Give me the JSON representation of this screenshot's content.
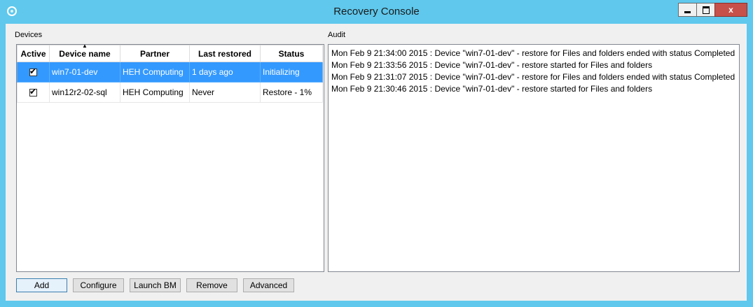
{
  "window": {
    "title": "Recovery Console",
    "min_icon": "minimize-icon",
    "max_icon": "maximize-icon",
    "close_glyph": "x"
  },
  "devices": {
    "label": "Devices",
    "columns": [
      "Active",
      "Device name",
      "Partner",
      "Last restored",
      "Status"
    ],
    "sorted_column": "Device name",
    "rows": [
      {
        "active": true,
        "device": "win7-01-dev",
        "partner": "HEH Computing",
        "last_restored": "1 days ago",
        "status": "Initializing",
        "selected": true
      },
      {
        "active": true,
        "device": "win12r2-02-sql",
        "partner": "HEH Computing",
        "last_restored": "Never",
        "status": "Restore - 1%",
        "selected": false
      }
    ]
  },
  "audit": {
    "label": "Audit",
    "lines": [
      "Mon Feb 9 21:34:00 2015 : Device \"win7-01-dev\" - restore for Files and folders ended with status Completed",
      "Mon Feb 9 21:33:56 2015 : Device \"win7-01-dev\" - restore started for Files and folders",
      "Mon Feb 9 21:31:07 2015 : Device \"win7-01-dev\" - restore for Files and folders ended with status Completed",
      "Mon Feb 9 21:30:46 2015 : Device \"win7-01-dev\" - restore started for Files and folders"
    ]
  },
  "buttons": {
    "add": "Add",
    "configure": "Configure",
    "launch": "Launch BM",
    "remove": "Remove",
    "advanced": "Advanced"
  },
  "colors": {
    "titlebar": "#5fc8ec",
    "selection": "#3399ff",
    "close": "#c7504a"
  }
}
